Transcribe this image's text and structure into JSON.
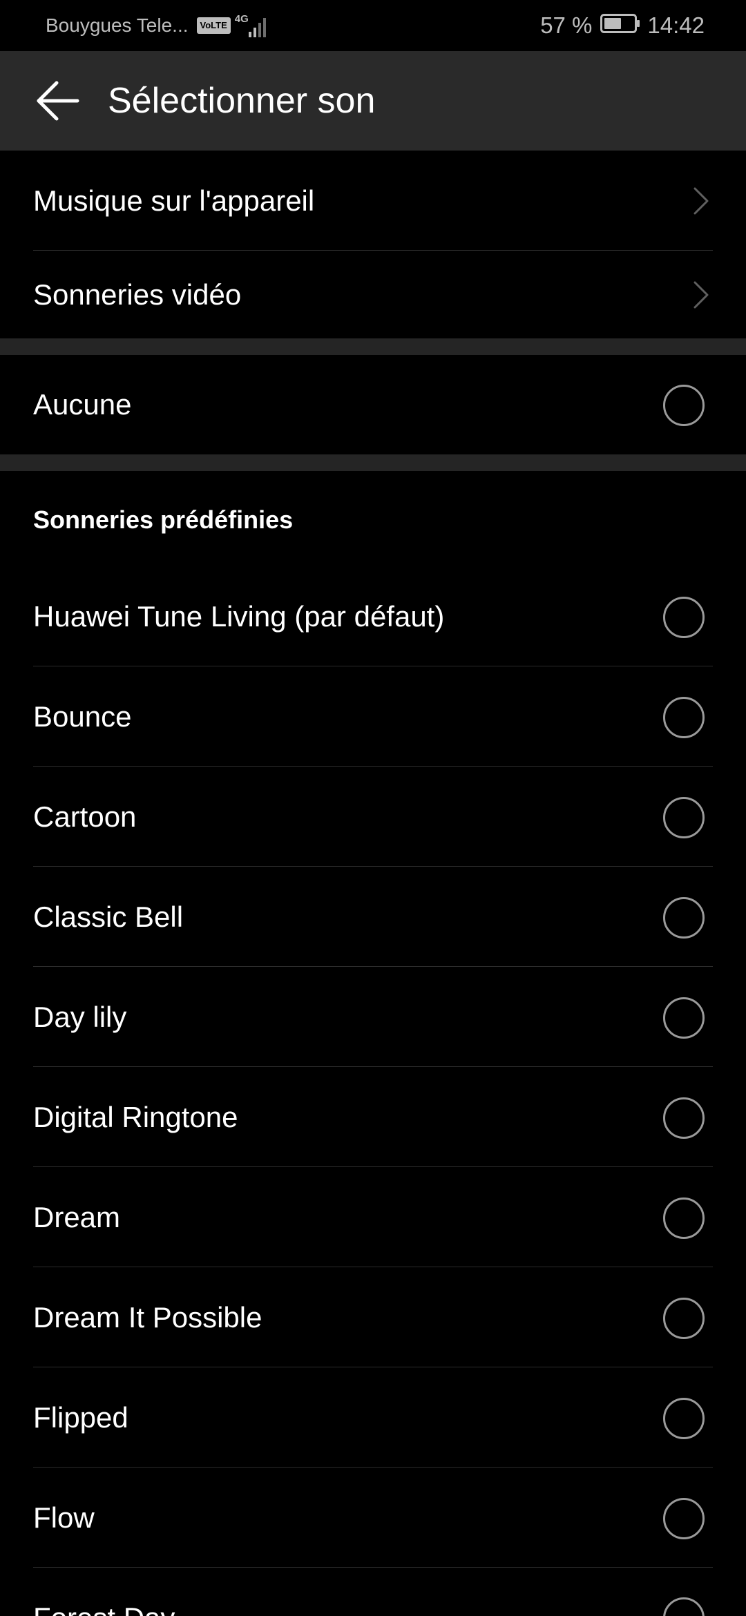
{
  "status_bar": {
    "carrier": "Bouygues Tele...",
    "volte": "VoLTE",
    "network": "4G",
    "battery": "57 %",
    "time": "14:42"
  },
  "header": {
    "title": "Sélectionner son"
  },
  "nav_items": [
    {
      "label": "Musique sur l'appareil"
    },
    {
      "label": "Sonneries vidéo"
    }
  ],
  "none_option": {
    "label": "Aucune"
  },
  "predefined": {
    "header": "Sonneries prédéfinies",
    "items": [
      {
        "label": "Huawei Tune Living (par défaut)"
      },
      {
        "label": "Bounce"
      },
      {
        "label": "Cartoon"
      },
      {
        "label": "Classic Bell"
      },
      {
        "label": "Day lily"
      },
      {
        "label": "Digital Ringtone"
      },
      {
        "label": "Dream"
      },
      {
        "label": "Dream It Possible"
      },
      {
        "label": "Flipped"
      },
      {
        "label": "Flow"
      },
      {
        "label": "Forest Day"
      }
    ]
  },
  "icons": {
    "back": "arrow-left-icon",
    "chevron": "chevron-right-icon",
    "radio": "radio-unselected-icon",
    "battery": "battery-icon",
    "signal": "signal-icon"
  },
  "colors": {
    "background": "#000000",
    "app_bar": "#2a2a2a",
    "section_gap": "#252525",
    "divider": "#2c2c2c",
    "text": "#ffffff",
    "status_text": "#bdbdbd",
    "radio_border": "#9a9a9a"
  }
}
